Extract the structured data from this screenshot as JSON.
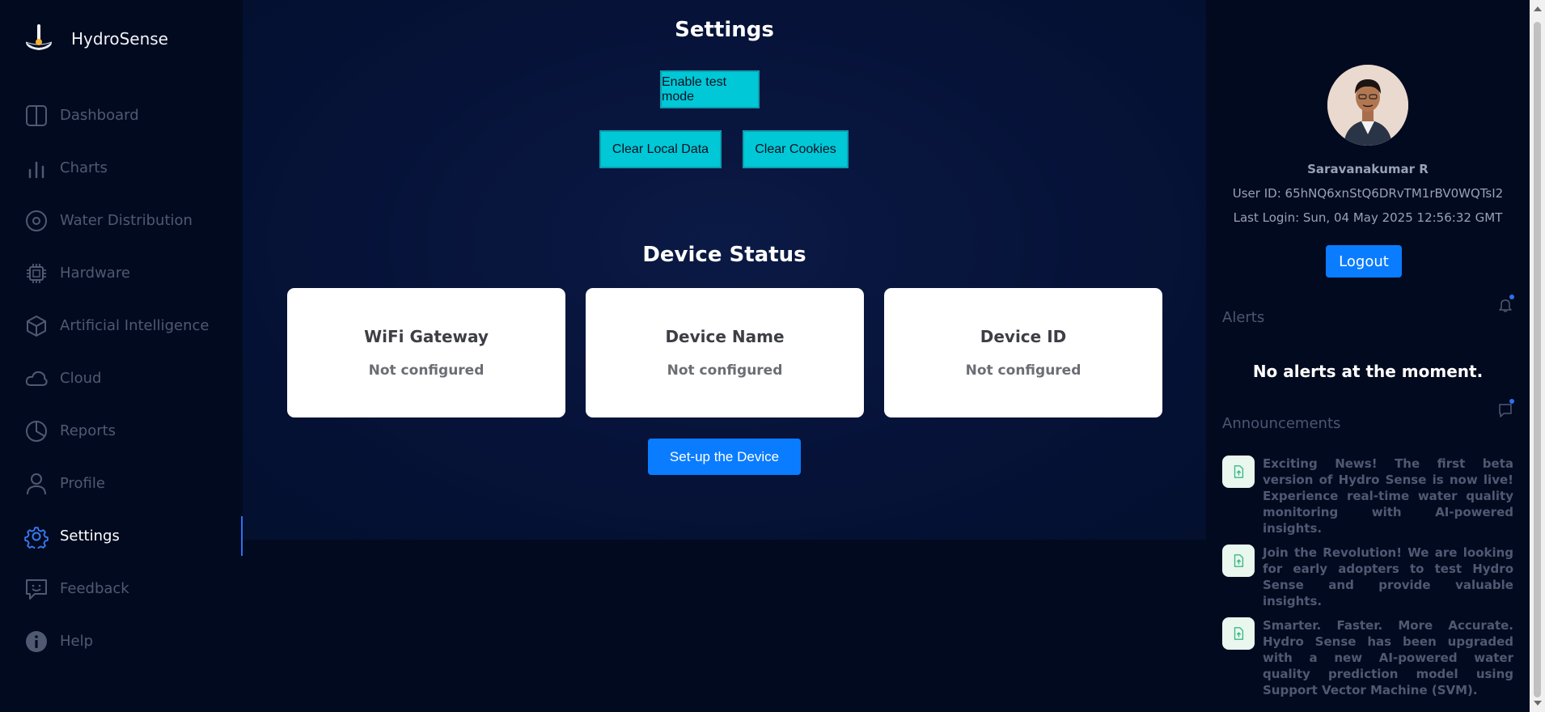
{
  "brand": {
    "name": "HydroSense"
  },
  "nav": [
    {
      "label": "Dashboard",
      "icon": "dashboard-icon"
    },
    {
      "label": "Charts",
      "icon": "chart-icon"
    },
    {
      "label": "Water Distribution",
      "icon": "target-icon"
    },
    {
      "label": "Hardware",
      "icon": "chip-icon"
    },
    {
      "label": "Artificial Intelligence",
      "icon": "cube-icon"
    },
    {
      "label": "Cloud",
      "icon": "cloud-icon"
    },
    {
      "label": "Reports",
      "icon": "pie-icon"
    },
    {
      "label": "Profile",
      "icon": "user-icon"
    },
    {
      "label": "Settings",
      "icon": "gear-icon",
      "active": true
    },
    {
      "label": "Feedback",
      "icon": "feedback-icon"
    },
    {
      "label": "Help",
      "icon": "info-icon"
    }
  ],
  "settings": {
    "title": "Settings",
    "enable_test_mode": "Enable test mode",
    "clear_local_data": "Clear Local Data",
    "clear_cookies": "Clear Cookies"
  },
  "device_status": {
    "title": "Device Status",
    "cards": [
      {
        "title": "WiFi Gateway",
        "value": "Not configured"
      },
      {
        "title": "Device Name",
        "value": "Not configured"
      },
      {
        "title": "Device ID",
        "value": "Not configured"
      }
    ],
    "setup_button": "Set-up the Device"
  },
  "user": {
    "name": "Saravanakumar R",
    "user_id": "User ID: 65hNQ6xnStQ6DRvTM1rBV0WQTsI2",
    "last_login": "Last Login: Sun, 04 May 2025 12:56:32 GMT",
    "logout": "Logout"
  },
  "alerts": {
    "title": "Alerts",
    "empty_message": "No alerts at the moment."
  },
  "announcements": {
    "title": "Announcements",
    "items": [
      "Exciting News! The first beta version of Hydro Sense is now live! Experience real-time water quality monitoring with AI-powered insights.",
      "Join the Revolution! We are looking for early adopters to test Hydro Sense and provide valuable insights.",
      "Smarter. Faster. More Accurate. Hydro Sense has been upgraded with a new AI-powered water quality prediction model using Support Vector Machine (SVM)."
    ]
  },
  "colors": {
    "accent": "#0a7cff",
    "teal": "#00c8d7",
    "sidebar_bg": "#020a1f",
    "nav_text": "#4f5972"
  }
}
